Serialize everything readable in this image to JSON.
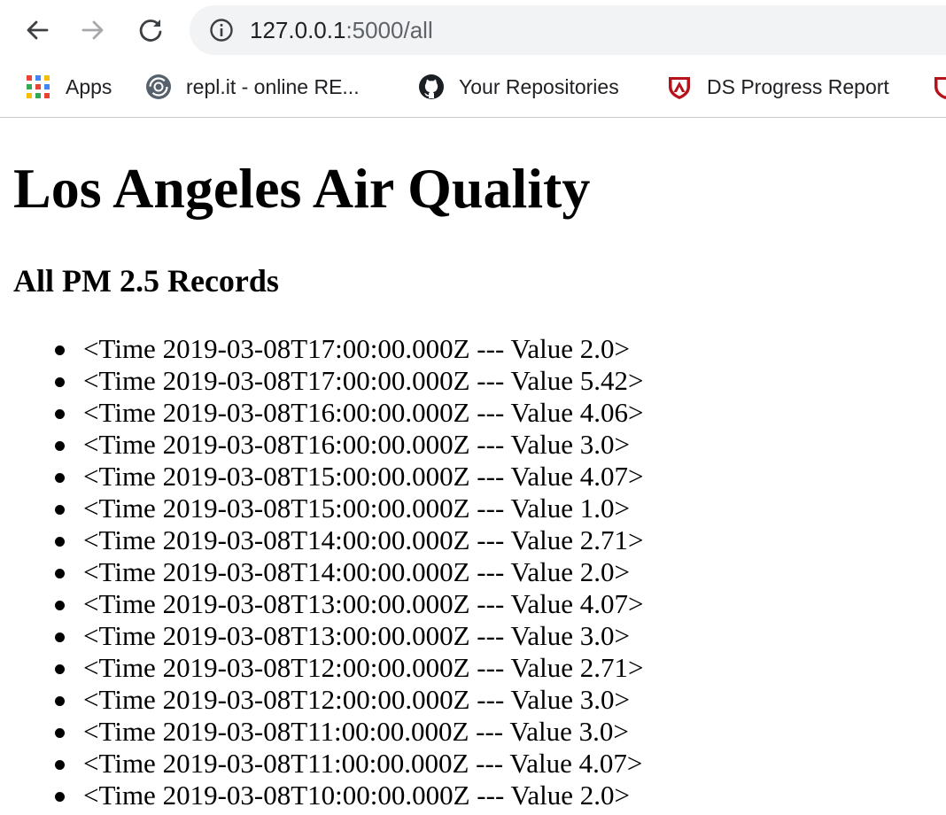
{
  "browser": {
    "address_bar": {
      "host": "127.0.0.1",
      "path": ":5000/all"
    },
    "bookmarks": [
      {
        "label": "Apps",
        "icon": "apps-grid-icon"
      },
      {
        "label": "repl.it - online RE...",
        "icon": "replit-icon"
      },
      {
        "label": "Your Repositories",
        "icon": "github-icon"
      },
      {
        "label": "DS Progress Report",
        "icon": "shield-logo-icon"
      }
    ]
  },
  "page": {
    "title": "Los Angeles Air Quality",
    "subtitle": "All PM 2.5 Records",
    "records": [
      "<Time 2019-03-08T17:00:00.000Z --- Value 2.0>",
      "<Time 2019-03-08T17:00:00.000Z --- Value 5.42>",
      "<Time 2019-03-08T16:00:00.000Z --- Value 4.06>",
      "<Time 2019-03-08T16:00:00.000Z --- Value 3.0>",
      "<Time 2019-03-08T15:00:00.000Z --- Value 4.07>",
      "<Time 2019-03-08T15:00:00.000Z --- Value 1.0>",
      "<Time 2019-03-08T14:00:00.000Z --- Value 2.71>",
      "<Time 2019-03-08T14:00:00.000Z --- Value 2.0>",
      "<Time 2019-03-08T13:00:00.000Z --- Value 4.07>",
      "<Time 2019-03-08T13:00:00.000Z --- Value 3.0>",
      "<Time 2019-03-08T12:00:00.000Z --- Value 2.71>",
      "<Time 2019-03-08T12:00:00.000Z --- Value 3.0>",
      "<Time 2019-03-08T11:00:00.000Z --- Value 3.0>",
      "<Time 2019-03-08T11:00:00.000Z --- Value 4.07>",
      "<Time 2019-03-08T10:00:00.000Z --- Value 2.0>"
    ]
  }
}
